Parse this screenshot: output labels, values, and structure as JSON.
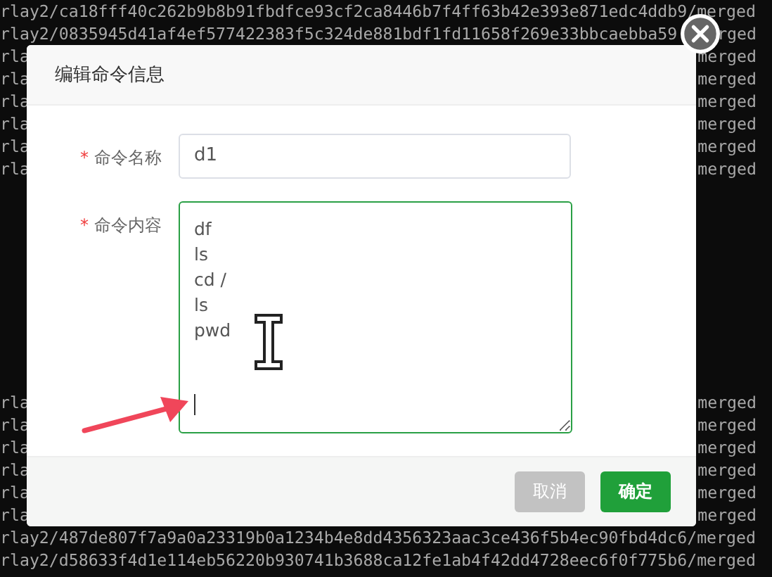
{
  "terminal": {
    "top_lines": [
      {
        "start": "rlay2/ca18fff40c262b9b8b91fbdfce93cf2ca8446b7f4ff63b42e393e871edc4ddb9/merged"
      },
      {
        "start": "rlay2/0835945d41af4ef577422383f5c324de881bdf1fd11658f269e33bbcaebba59",
        "end": "rged"
      },
      {
        "start": "rla",
        "end": "merged"
      },
      {
        "start": "rla",
        "end": "merged"
      },
      {
        "start": "rla",
        "end": "merged"
      },
      {
        "start": "rla",
        "end": "merged"
      },
      {
        "start": "rla",
        "end": "merged"
      },
      {
        "start": "rla",
        "end": "merged"
      }
    ],
    "bottom_lines": [
      {
        "start": "rla",
        "end": "merged"
      },
      {
        "start": "rla",
        "end": "merged"
      },
      {
        "start": "rla",
        "end": "merged"
      },
      {
        "start": "rla",
        "end": "merged"
      },
      {
        "start": "rla",
        "end": "merged"
      },
      {
        "start": "rla",
        "end": "merged"
      },
      {
        "start": "rlay2/487de807f7a9a0a23319b0a1234b4e8dd4356323aac3ce436f5b4ec90fbd4dc6/merged"
      },
      {
        "start": "rlay2/d58633f4d1e114eb56220b930741b3688ca12fe1ab4f42dd4728eec6f0f775b6/merged"
      }
    ]
  },
  "dialog": {
    "title": "编辑命令信息",
    "fields": [
      {
        "kind": "input",
        "required": true,
        "marker": "*",
        "label": "命令名称",
        "value": "d1",
        "focused": false
      },
      {
        "kind": "textarea",
        "required": true,
        "marker": "*",
        "label": "命令内容",
        "value": "df\nls\ncd /\nls\npwd\n\n\n",
        "focused": true
      }
    ],
    "buttons": [
      {
        "kind": "secondary",
        "label": "取消"
      },
      {
        "kind": "primary",
        "label": "确定"
      }
    ]
  }
}
